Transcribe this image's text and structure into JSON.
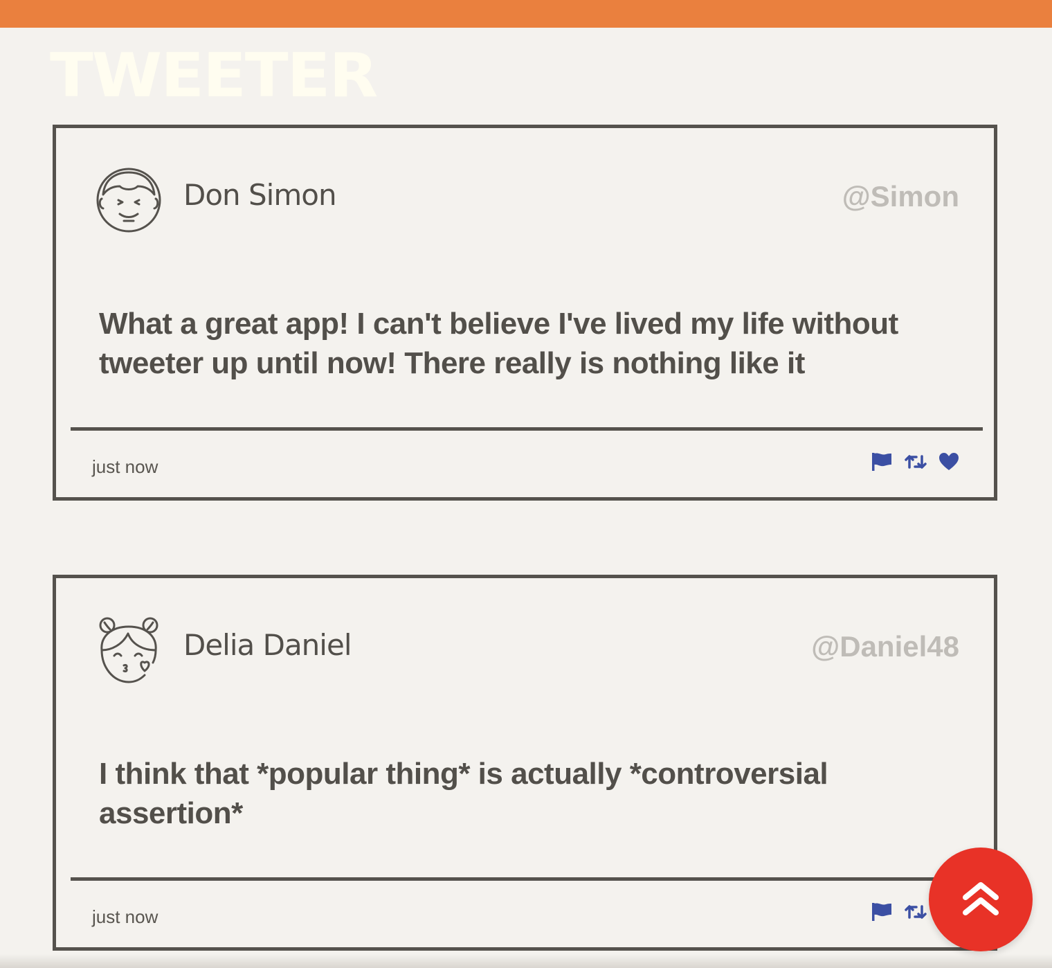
{
  "app": {
    "logo": "TWEETER"
  },
  "colors": {
    "top_bar": "#ea803e",
    "background": "#f4f2ee",
    "border": "#55524d",
    "handle": "#bfbcb7",
    "action_icons": "#3b4fa3",
    "scroll_top_button": "#e83227",
    "logo": "#fffdf0"
  },
  "tweets": [
    {
      "avatar_icon": "boy-face-icon",
      "author_name": "Don Simon",
      "handle": "@Simon",
      "content": "What a great app! I can't believe I've lived my life without tweeter up until now! There really is nothing like it",
      "timestamp": "just now",
      "actions": [
        "flag-icon",
        "retweet-icon",
        "heart-icon"
      ]
    },
    {
      "avatar_icon": "girl-kiss-face-icon",
      "author_name": "Delia Daniel",
      "handle": "@Daniel48",
      "content": "I think that *popular thing* is actually *controversial assertion*",
      "timestamp": "just now",
      "actions": [
        "flag-icon",
        "retweet-icon",
        "heart-icon"
      ]
    }
  ],
  "scroll_top": {
    "icon": "double-chevron-up-icon"
  }
}
